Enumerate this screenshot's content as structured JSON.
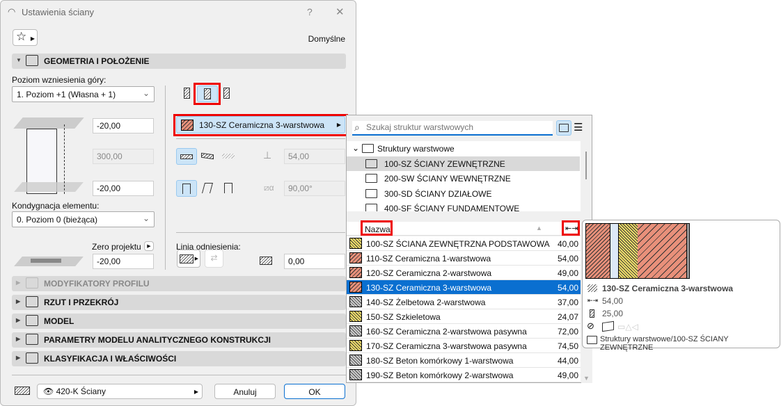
{
  "dialog": {
    "title": "Ustawienia ściany",
    "help": "?",
    "close": "✕",
    "favorites_icon": "star-icon",
    "preset": "Domyślne"
  },
  "geometry": {
    "section": "GEOMETRIA I POŁOŻENIE",
    "top_link_label": "Poziom wzniesienia góry:",
    "top_link_value": "1. Poziom +1 (Własna + 1)",
    "top_offset": "-20,00",
    "height": "300,00",
    "bottom_offset": "-20,00",
    "home_story_label": "Kondygnacja elementu:",
    "home_story_value": "0. Poziom 0 (bieżąca)",
    "project_zero_label": "Zero projektu",
    "project_zero_value": "-20,00",
    "composite": "130-SZ Ceramiczna  3-warstwowa",
    "thickness": "54,00",
    "angle": "90,00°",
    "ref_line_label": "Linia odniesienia:",
    "ref_offset": "0,00"
  },
  "sections": [
    {
      "label": "MODYFIKATORY PROFILU",
      "disabled": true
    },
    {
      "label": "RZUT I PRZEKRÓJ"
    },
    {
      "label": "MODEL"
    },
    {
      "label": "PARAMETRY MODELU ANALITYCZNEGO KONSTRUKCJI"
    },
    {
      "label": "KLASYFIKACJA I WŁAŚCIWOŚCI"
    }
  ],
  "footer": {
    "layer": "420-K Ściany",
    "cancel": "Anuluj",
    "ok": "OK"
  },
  "popup": {
    "search_placeholder": "Szukaj struktur warstwowych",
    "tree": [
      "Struktury warstwowe",
      "100-SZ ŚCIANY ZEWNĘTRZNE",
      "200-SW ŚCIANY WEWNĘTRZNE",
      "300-SD ŚCIANY DZIAŁOWE",
      "400-SF ŚCIANY FUNDAMENTOWE"
    ],
    "col_name": "Nazwa",
    "rows": [
      {
        "name": "100-SZ ŚCIANA ZEWNĘTRZNA PODSTAWOWA",
        "v": "40,00"
      },
      {
        "name": "110-SZ Ceramiczna 1-warstwowa",
        "v": "54,00"
      },
      {
        "name": "120-SZ Ceramiczna 2-warstwowa",
        "v": "49,00"
      },
      {
        "name": "130-SZ Ceramiczna  3-warstwowa",
        "v": "54,00"
      },
      {
        "name": "140-SZ Żelbetowa  2-warstwowa",
        "v": "37,00"
      },
      {
        "name": "150-SZ Szkieletowa",
        "v": "24,07"
      },
      {
        "name": "160-SZ Ceramiczna 2-warstwowa pasywna",
        "v": "72,00"
      },
      {
        "name": "170-SZ Ceramiczna 3-warstwowa pasywna",
        "v": "74,50"
      },
      {
        "name": "180-SZ Beton komórkowy 1-warstwowa",
        "v": "44,00"
      },
      {
        "name": "190-SZ Beton komórkowy 2-warstwowa",
        "v": "49,00"
      }
    ],
    "selected_index": 3
  },
  "tooltip": {
    "name": "130-SZ Ceramiczna  3-warstwowa",
    "thickness": "54,00",
    "core": "25,00",
    "path": "Struktury warstwowe/100-SZ ŚCIANY ZEWNĘTRZNE"
  },
  "colors": {
    "selection": "#0a6fd0",
    "highlight": "#e00000",
    "brick": "#e8907a",
    "insulation": "#f5e06a"
  }
}
